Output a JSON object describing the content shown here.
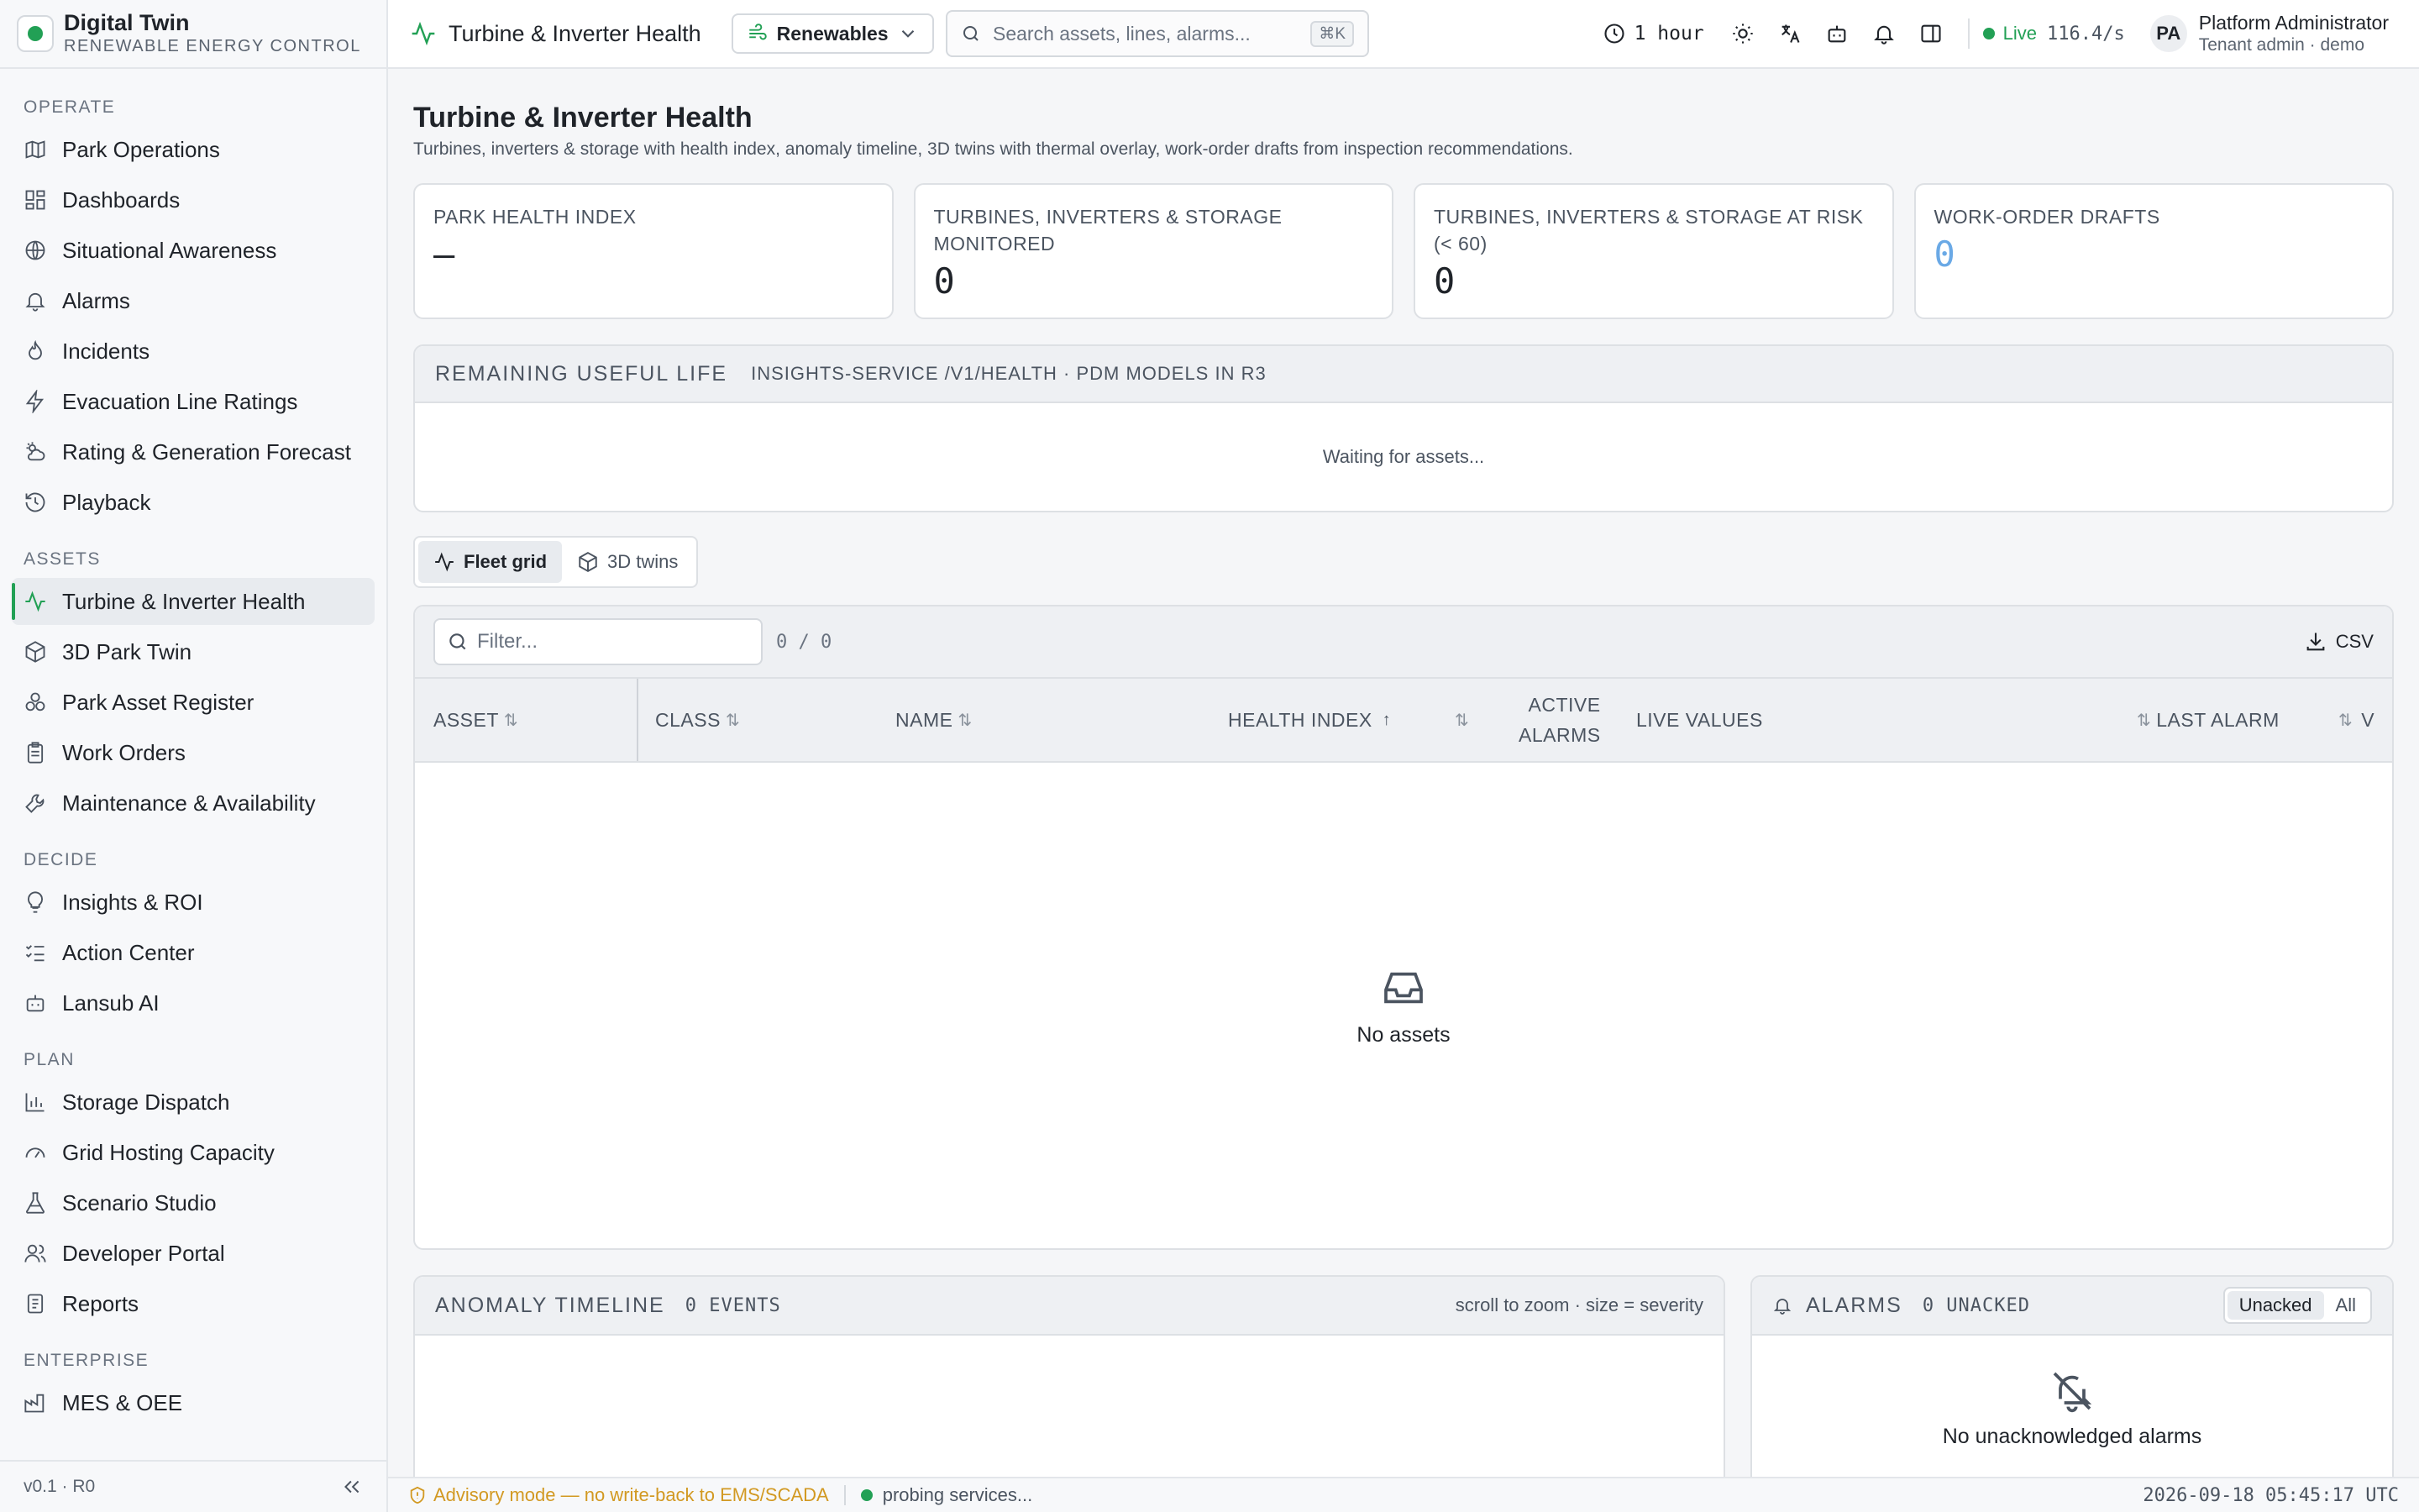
{
  "brand": {
    "title": "Digital Twin",
    "subtitle": "RENEWABLE ENERGY CONTROL"
  },
  "sidebar": {
    "sections": [
      {
        "label": "OPERATE",
        "items": [
          "Park Operations",
          "Dashboards",
          "Situational Awareness",
          "Alarms",
          "Incidents",
          "Evacuation Line Ratings",
          "Rating & Generation Forecast",
          "Playback"
        ]
      },
      {
        "label": "ASSETS",
        "items": [
          "Turbine & Inverter Health",
          "3D Park Twin",
          "Park Asset Register",
          "Work Orders",
          "Maintenance & Availability"
        ]
      },
      {
        "label": "DECIDE",
        "items": [
          "Insights & ROI",
          "Action Center",
          "Lansub AI"
        ]
      },
      {
        "label": "PLAN",
        "items": [
          "Storage Dispatch",
          "Grid Hosting Capacity",
          "Scenario Studio",
          "Developer Portal",
          "Reports"
        ]
      },
      {
        "label": "ENTERPRISE",
        "items": [
          "MES & OEE"
        ]
      }
    ],
    "active": "Turbine & Inverter Health",
    "version": "v0.1 · R0"
  },
  "topbar": {
    "title": "Turbine & Inverter Health",
    "domain_select": "Renewables",
    "search_placeholder": "Search assets, lines, alarms...",
    "search_shortcut": "⌘K",
    "time_range": "1 hour",
    "live_label": "Live",
    "live_rate": "116.4/s",
    "user_initials": "PA",
    "user_name": "Platform Administrator",
    "user_role": "Tenant admin · demo"
  },
  "page": {
    "title": "Turbine & Inverter Health",
    "subtitle": "Turbines, inverters & storage with health index, anomaly timeline, 3D twins with thermal overlay, work-order drafts from inspection recommendations."
  },
  "kpis": [
    {
      "label": "PARK HEALTH INDEX",
      "value": "—"
    },
    {
      "label": "TURBINES, INVERTERS & STORAGE MONITORED",
      "value": "0"
    },
    {
      "label": "TURBINES, INVERTERS & STORAGE AT RISK (< 60)",
      "value": "0"
    },
    {
      "label": "WORK-ORDER DRAFTS",
      "value": "0"
    }
  ],
  "rul": {
    "title": "REMAINING USEFUL LIFE",
    "meta": "INSIGHTS-SERVICE /V1/HEALTH · PDM MODELS IN R3",
    "empty": "Waiting for assets..."
  },
  "views": {
    "fleet_grid": "Fleet grid",
    "twins": "3D twins"
  },
  "grid": {
    "filter_placeholder": "Filter...",
    "count": "0 / 0",
    "csv": "CSV",
    "columns": {
      "asset": "ASSET",
      "class": "CLASS",
      "name": "NAME",
      "health": "HEALTH INDEX",
      "active_alarms_1": "ACTIVE",
      "active_alarms_2": "ALARMS",
      "live_values": "LIVE VALUES",
      "last_alarm": "LAST ALARM",
      "v": "V"
    },
    "empty": "No assets"
  },
  "anomaly": {
    "title": "ANOMALY TIMELINE",
    "count": "0 EVENTS",
    "hint": "scroll to zoom · size = severity"
  },
  "alarms": {
    "title": "ALARMS",
    "count": "0 UNACKED",
    "tab_unacked": "Unacked",
    "tab_all": "All",
    "empty": "No unacknowledged alarms"
  },
  "statusbar": {
    "advisory": "Advisory mode — no write-back to EMS/SCADA",
    "probe": "probing services...",
    "clock": "2026-09-18 05:45:17 UTC"
  },
  "colors": {
    "accent": "#22a055",
    "warning": "#d29922",
    "kpi_blue": "#6aa9e6"
  }
}
